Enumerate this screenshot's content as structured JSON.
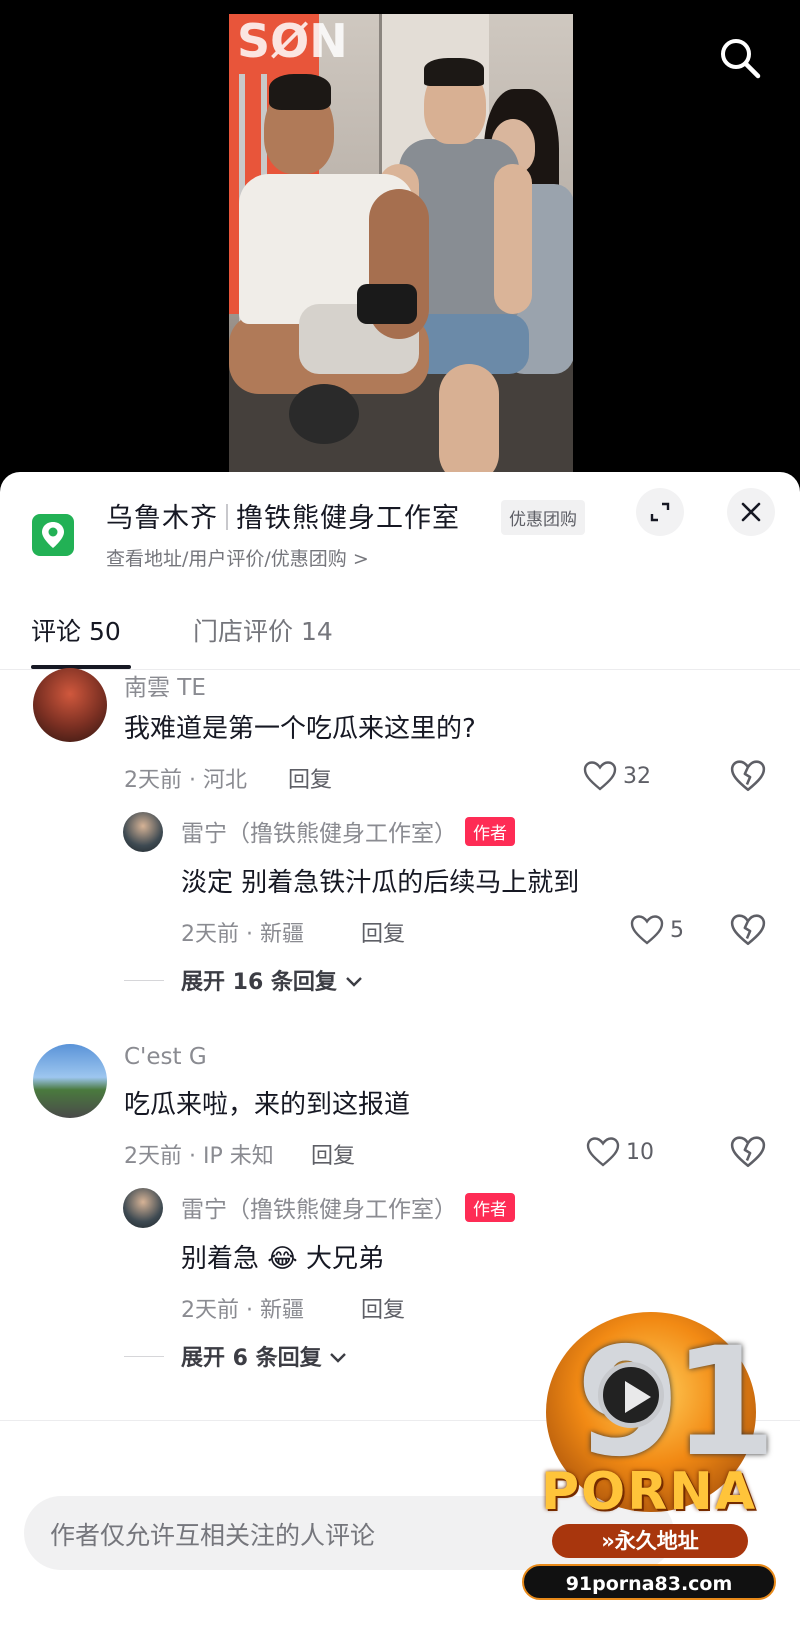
{
  "video": {
    "wall_text": "SØN"
  },
  "poi": {
    "city": "乌鲁木齐",
    "name": "撸铁熊健身工作室",
    "badge": "优惠团购",
    "subtitle": "查看地址/用户评价/优惠团购 >"
  },
  "tabs": [
    {
      "label": "评论 50"
    },
    {
      "label": "门店评价 14"
    }
  ],
  "comments": [
    {
      "author": "南雲 TE",
      "text": "我难道是第一个吃瓜来这里的?",
      "meta": "2天前 · 河北",
      "reply_label": "回复",
      "likes": "32",
      "reply": {
        "author": "雷宁（撸铁熊健身工作室）",
        "badge": "作者",
        "text": "淡定 别着急铁汁瓜的后续马上就到",
        "meta": "2天前 · 新疆",
        "reply_label": "回复",
        "likes": "5"
      },
      "expand": "展开 16 条回复"
    },
    {
      "author": "C'est G",
      "text": "吃瓜来啦，来的到这报道",
      "meta": "2天前 · IP 未知",
      "reply_label": "回复",
      "likes": "10",
      "reply": {
        "author": "雷宁（撸铁熊健身工作室）",
        "badge": "作者",
        "text_before": "别着急",
        "emoji": "😂",
        "text_after": "大兄弟",
        "meta": "2天前 · 新疆",
        "reply_label": "回复"
      },
      "expand": "展开 6 条回复"
    }
  ],
  "input": {
    "placeholder": "作者仅允许互相关注的人评论"
  },
  "watermark": {
    "number": "91",
    "brand": "PORNA",
    "tag": "»永久地址",
    "url": "91porna83.com"
  },
  "colors": {
    "accent_red": "#fe2c55",
    "pin_green": "#22b155"
  }
}
